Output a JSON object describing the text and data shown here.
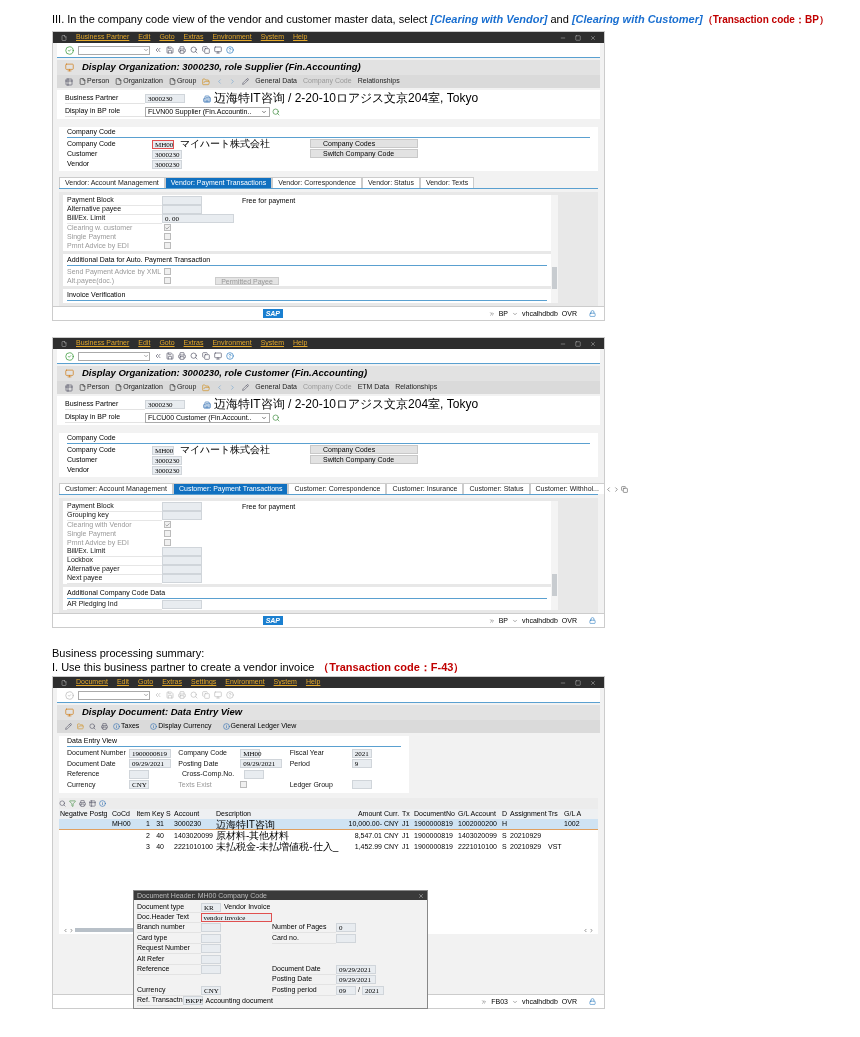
{
  "heading": [
    {
      "kind": "plain",
      "text": "III. In the company code view of the vendor and customer master data, select "
    },
    {
      "kind": "emph",
      "text": "[Clearing with Vendor]"
    },
    {
      "kind": "plain",
      "text": " and "
    },
    {
      "kind": "emph",
      "text": "[Clearing with Customer]"
    },
    {
      "kind": "code",
      "text": "（Transaction code：BP）"
    }
  ],
  "bp_windows": [
    {
      "menu": [
        "Business Partner",
        "Edit",
        "Goto",
        "Extras",
        "Environment",
        "System",
        "Help"
      ],
      "title": "Display Organization: 3000230, role Supplier (Fin.Accounting)",
      "nav": [
        {
          "kind": "doc",
          "label": "Person",
          "disabled": false
        },
        {
          "kind": "doc",
          "label": "Organization",
          "disabled": false
        },
        {
          "kind": "doc",
          "label": "Group",
          "disabled": false
        },
        {
          "kind": "text",
          "label": "General Data",
          "disabled": false
        },
        {
          "kind": "text",
          "label": "Company Code",
          "disabled": true
        },
        {
          "kind": "text",
          "label": "Relationships",
          "disabled": false
        }
      ],
      "partner": {
        "label": "Business Partner",
        "value": "3000230",
        "address": "迈海特IT咨询 / 2-20-10ロアジス文京204室, Tokyo"
      },
      "role": {
        "label": "Display in BP role",
        "value": "FLVN00 Supplier (Fin.Accountin.."
      },
      "company_group": {
        "title": "Company Code",
        "fields": [
          {
            "label": "Company Code",
            "value": "MH00",
            "focused": true,
            "name": "マイハート株式会社"
          },
          {
            "label": "Customer",
            "value": "3000230",
            "focused": false
          },
          {
            "label": "Vendor",
            "value": "3000230",
            "focused": false
          }
        ],
        "buttons": [
          "Company Codes",
          "Switch Company Code"
        ]
      },
      "tabs": [
        {
          "label": "Vendor: Account Management",
          "selected": false
        },
        {
          "label": "Vendor: Payment Transactions",
          "selected": true
        },
        {
          "label": "Vendor: Correspondence",
          "selected": false
        },
        {
          "label": "Vendor: Status",
          "selected": false
        },
        {
          "label": "Vendor: Texts",
          "selected": false
        }
      ],
      "tab_arrows": false,
      "sections": [
        {
          "fields": [
            {
              "kind": "input",
              "label": "Payment Block",
              "note": "Free for payment"
            },
            {
              "kind": "input",
              "label": "Alternative payee"
            },
            {
              "kind": "input",
              "label": "Bill/Ex. Limit",
              "value": "0. 00"
            },
            {
              "kind": "check",
              "label": "Clearing w. customer",
              "checked": true,
              "disabled": true
            },
            {
              "kind": "check",
              "label": "Single Payment",
              "checked": false,
              "disabled": true
            },
            {
              "kind": "check",
              "label": "Pmnt Advice by EDI",
              "checked": false,
              "disabled": true
            }
          ]
        },
        {
          "title": "Additional Data for Auto. Payment Transaction",
          "fields": [
            {
              "kind": "check",
              "label": "Send Payment Advice by XML",
              "checked": false,
              "disabled": true
            },
            {
              "kind": "check",
              "label": "Alt.payee(doc.)",
              "checked": false,
              "disabled": true,
              "button": {
                "label": "Permitted Payee",
                "disabled": true
              }
            }
          ]
        },
        {
          "title": "Invoice Verification"
        }
      ],
      "status": {
        "logo": "SAP",
        "sid": "BP",
        "server": "vhcalhdbdb",
        "mode": "OVR"
      }
    },
    {
      "menu": [
        "Business Partner",
        "Edit",
        "Goto",
        "Extras",
        "Environment",
        "System",
        "Help"
      ],
      "title": "Display Organization: 3000230, role Customer (Fin.Accounting)",
      "nav": [
        {
          "kind": "doc",
          "label": "Person",
          "disabled": false
        },
        {
          "kind": "doc",
          "label": "Organization",
          "disabled": false
        },
        {
          "kind": "doc",
          "label": "Group",
          "disabled": false
        },
        {
          "kind": "text",
          "label": "General Data",
          "disabled": false
        },
        {
          "kind": "text",
          "label": "Company Code",
          "disabled": true
        },
        {
          "kind": "text",
          "label": "ETM Data",
          "disabled": false
        },
        {
          "kind": "text",
          "label": "Relationships",
          "disabled": false
        }
      ],
      "partner": {
        "label": "Business Partner",
        "value": "3000230",
        "address": "迈海特IT咨询 / 2-20-10ロアジス文京204室, Tokyo"
      },
      "role": {
        "label": "Display in BP role",
        "value": "FLCU00 Customer (Fin.Account.."
      },
      "company_group": {
        "title": "Company Code",
        "fields": [
          {
            "label": "Company Code",
            "value": "MH00",
            "focused": false,
            "name": "マイハート株式会社"
          },
          {
            "label": "Customer",
            "value": "3000230",
            "focused": false
          },
          {
            "label": "Vendor",
            "value": "3000230",
            "focused": false
          }
        ],
        "buttons": [
          "Company Codes",
          "Switch Company Code"
        ]
      },
      "tabs": [
        {
          "label": "Customer: Account Management",
          "selected": false
        },
        {
          "label": "Customer: Payment Transactions",
          "selected": true
        },
        {
          "label": "Customer: Correspondence",
          "selected": false
        },
        {
          "label": "Customer: Insurance",
          "selected": false
        },
        {
          "label": "Customer: Status",
          "selected": false
        },
        {
          "label": "Customer: Withhol...",
          "selected": false
        }
      ],
      "tab_arrows": true,
      "sections": [
        {
          "fields": [
            {
              "kind": "input",
              "label": "Payment Block",
              "note": "Free for payment"
            },
            {
              "kind": "input",
              "label": "Grouping key"
            },
            {
              "kind": "check",
              "label": "Clearing with Vendor",
              "checked": true,
              "disabled": true
            },
            {
              "kind": "check",
              "label": "Single Payment",
              "checked": false,
              "disabled": true
            },
            {
              "kind": "check",
              "label": "Pmnt Advice by EDI",
              "checked": false,
              "disabled": true
            },
            {
              "kind": "input",
              "label": "Bill/Ex. Limit"
            },
            {
              "kind": "input",
              "label": "Lockbox"
            },
            {
              "kind": "input",
              "label": "Alternative payer"
            },
            {
              "kind": "input",
              "label": "Next payee"
            }
          ]
        },
        {
          "title": "Additional Company Code Data",
          "fields": [
            {
              "kind": "input",
              "label": "AR Pledging Ind"
            }
          ]
        }
      ],
      "status": {
        "logo": "SAP",
        "sid": "BP",
        "server": "vhcalhdbdb",
        "mode": "OVR"
      }
    }
  ],
  "summary": {
    "title": "Business processing summary:",
    "step": "I.  Use this business partner to create a vendor invoice",
    "code": "（Transaction code：F-43）"
  },
  "doc_window": {
    "menu": [
      "Document",
      "Edit",
      "Goto",
      "Extras",
      "Settings",
      "Environment",
      "System",
      "Help"
    ],
    "toolbar_enabled": false,
    "title": "Display Document: Data Entry View",
    "nav": [
      "Taxes",
      "Display Currency",
      "General Ledger View"
    ],
    "group": {
      "title": "Data Entry View",
      "rows": [
        [
          {
            "kind": "input",
            "label": "Document Number",
            "value": "1900000819"
          },
          {
            "kind": "input",
            "label": "Company Code",
            "value": "MH00"
          },
          {
            "kind": "input",
            "label": "Fiscal Year",
            "value": "2021"
          }
        ],
        [
          {
            "kind": "input",
            "label": "Document Date",
            "value": "09/29/2021"
          },
          {
            "kind": "input",
            "label": "Posting Date",
            "value": "09/29/2021"
          },
          {
            "kind": "input",
            "label": "Period",
            "value": "9"
          }
        ],
        [
          {
            "kind": "input",
            "label": "Reference"
          },
          {
            "kind": "input",
            "label": "Cross-Comp.No."
          }
        ],
        [
          {
            "kind": "input",
            "label": "Currency",
            "value": "CNY"
          },
          {
            "kind": "check",
            "label": "Texts Exist",
            "checked": false,
            "disabled": true
          },
          {
            "kind": "input",
            "label": "Ledger Group"
          }
        ]
      ]
    },
    "table": {
      "columns": [
        "Negative Postg",
        "CoCd",
        "Item",
        "Key",
        "S",
        "Account",
        "Description",
        "Amount",
        "Curr.",
        "Tx",
        "DocumentNo",
        "G/L Account",
        "D",
        "Assignment",
        "Trs",
        "G/L A"
      ],
      "rows": [
        {
          "selected": true,
          "cells": [
            "",
            "MH00",
            "1",
            "31",
            "",
            "3000230",
            "迈海特IT咨询",
            "10,000.00-",
            "CNY",
            "J1",
            "1900000819",
            "1002000200",
            "H",
            "",
            "",
            "1002"
          ]
        },
        {
          "selected": false,
          "cells": [
            "",
            "",
            "2",
            "40",
            "",
            "1403020099",
            "原材料-其他材料",
            "8,547.01",
            "CNY",
            "J1",
            "1900000819",
            "1403020099",
            "S",
            "20210929",
            "",
            ""
          ]
        },
        {
          "selected": false,
          "cells": [
            "",
            "",
            "3",
            "40",
            "",
            "2221010100",
            "未払税金-未払増値税-仕入_",
            "1,452.99",
            "CNY",
            "J1",
            "1900000819",
            "2221010100",
            "S",
            "20210929",
            "VST",
            ""
          ]
        }
      ]
    },
    "dialog": {
      "title": "Document Header: MH00 Company Code",
      "rows": [
        {
          "left": {
            "label": "Document type",
            "value": "KR",
            "suffix": "Vendor Invoice"
          }
        },
        {
          "left": {
            "label": "Doc.Header Text",
            "value": "vendor invoice",
            "focused": true
          }
        },
        {
          "left": {
            "label": "Branch number"
          },
          "right": {
            "label": "Number of Pages",
            "value": "0"
          }
        },
        {
          "left": {
            "label": "Card type"
          },
          "right": {
            "label": "Card no."
          }
        },
        {
          "left": {
            "label": "Request Number"
          }
        },
        {
          "left": {
            "label": "Alt Refer"
          }
        },
        {
          "left": {
            "label": "Reference"
          },
          "right": {
            "label": "Document Date",
            "value": "09/29/2021"
          }
        },
        {
          "right": {
            "label": "Posting Date",
            "value": "09/29/2021"
          }
        },
        {
          "left": {
            "label": "Currency",
            "value": "CNY"
          },
          "right": {
            "label": "Posting period",
            "value": "09",
            "sep": "/",
            "value2": "2021"
          }
        },
        {
          "left": {
            "label": "Ref. Transactn",
            "value": "BKPF",
            "suffix": "Accounting document"
          }
        }
      ]
    },
    "status": {
      "sid": "FB03",
      "server": "vhcalhdbdb",
      "mode": "OVR"
    }
  }
}
